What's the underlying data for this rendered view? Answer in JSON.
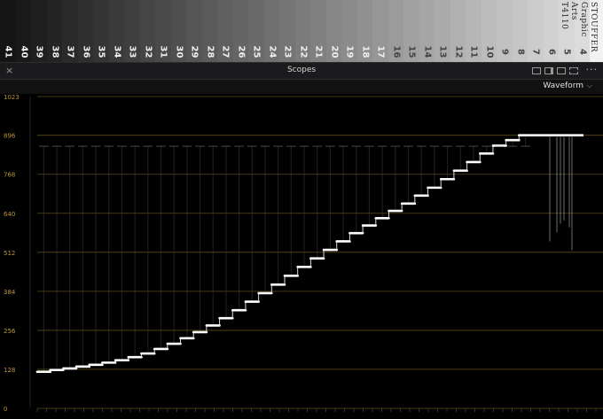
{
  "chart_strip": {
    "numbers": [
      "41",
      "40",
      "39",
      "38",
      "37",
      "36",
      "35",
      "34",
      "33",
      "32",
      "31",
      "30",
      "29",
      "28",
      "27",
      "26",
      "25",
      "24",
      "23",
      "22",
      "21",
      "20",
      "19",
      "18",
      "17",
      "16",
      "15",
      "14",
      "13",
      "12",
      "11",
      "10",
      "9",
      "8",
      "7",
      "6",
      "5",
      "4"
    ],
    "brand_lines": [
      "STOUFFER",
      "Graphic Arts",
      "T4110"
    ]
  },
  "panel": {
    "close_icon": "×",
    "title": "Scopes",
    "more_icon": "···",
    "layout_icons": [
      "layout-single-icon",
      "layout-2up-icon",
      "layout-3up-icon",
      "layout-4up-icon"
    ]
  },
  "toolbar": {
    "mode": "Waveform",
    "mode_chevron": "⌵"
  },
  "chart_data": {
    "type": "waveform",
    "y_ticks": [
      "1023",
      "896",
      "768",
      "640",
      "512",
      "384",
      "256",
      "128",
      "0"
    ],
    "ylim": [
      0,
      1023
    ],
    "grid": true,
    "gridline_color": "#5a4a1e",
    "tick_label_color": "#b9963a",
    "steps": [
      120,
      126,
      131,
      137,
      143,
      150,
      158,
      168,
      180,
      195,
      212,
      230,
      250,
      272,
      296,
      322,
      350,
      378,
      406,
      435,
      464,
      492,
      520,
      548,
      575,
      600,
      624,
      648,
      672,
      698,
      724,
      752,
      780,
      808,
      836,
      862,
      880,
      896
    ],
    "top_streak_y": 860,
    "right_cluster": {
      "y": 896,
      "floor": 500
    }
  }
}
